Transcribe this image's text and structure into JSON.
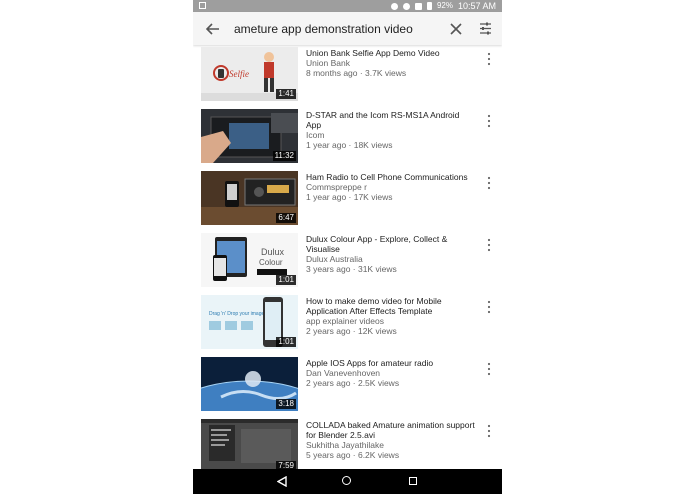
{
  "status_bar": {
    "battery": "92%",
    "time": "10:57 AM"
  },
  "search": {
    "query": "ameture app demonstration video"
  },
  "videos": [
    {
      "title": "Union Bank Selfie App Demo Video",
      "channel": "Union Bank",
      "meta": "8 months ago · 3.7K views",
      "duration": "1:41"
    },
    {
      "title": "D-STAR and the Icom RS-MS1A Android App",
      "channel": "Icom",
      "meta": "1 year ago · 18K views",
      "duration": "11:32"
    },
    {
      "title": "Ham Radio to Cell Phone Communications",
      "channel": "Commspreppe r",
      "meta": "1 year ago · 17K views",
      "duration": "6:47"
    },
    {
      "title": "Dulux Colour App - Explore, Collect & Visualise",
      "channel": "Dulux Australia",
      "meta": "3 years ago · 31K views",
      "duration": "1:01"
    },
    {
      "title": "How to make demo video for Mobile Application After Effects Template",
      "channel": "app explainer videos",
      "meta": "2 years ago · 12K views",
      "duration": "1:01"
    },
    {
      "title": "Apple IOS Apps for amateur radio",
      "channel": "Dan Vanevenhoven",
      "meta": "2 years ago · 2.5K views",
      "duration": "3:18"
    },
    {
      "title": "COLLADA baked Amature animation support for Blender 2.5.avi",
      "channel": "Sukhitha Jayathilake",
      "meta": "5 years ago · 6.2K views",
      "duration": "7:59"
    }
  ],
  "thumbnail_text": {
    "selfie_logo": "Selfie",
    "dulux_logo": "Dulux",
    "dulux_sub": "Colour",
    "drag_drop": "Drag 'n' Drop your images"
  }
}
